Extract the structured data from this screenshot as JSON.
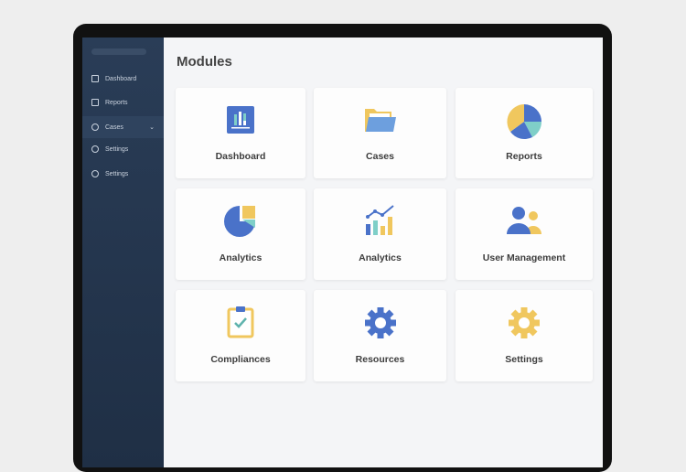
{
  "sidebar": {
    "items": [
      {
        "label": "Dashboard",
        "icon": "dashboard-icon"
      },
      {
        "label": "Reports",
        "icon": "reports-icon"
      },
      {
        "label": "Cases",
        "icon": "search-icon",
        "expandable": true
      },
      {
        "label": "Settings",
        "icon": "settings-icon"
      },
      {
        "label": "Settings",
        "icon": "settings-icon"
      }
    ]
  },
  "main": {
    "title": "Modules",
    "modules": [
      {
        "label": "Dashboard",
        "icon": "dashboard-chart-icon"
      },
      {
        "label": "Cases",
        "icon": "folder-icon"
      },
      {
        "label": "Reports",
        "icon": "pie-chart-icon"
      },
      {
        "label": "Analytics",
        "icon": "pie-chart-icon"
      },
      {
        "label": "Analytics",
        "icon": "bar-line-chart-icon"
      },
      {
        "label": "User Management",
        "icon": "users-icon"
      },
      {
        "label": "Compliances",
        "icon": "clipboard-check-icon"
      },
      {
        "label": "Resources",
        "icon": "gear-icon"
      },
      {
        "label": "Settings",
        "icon": "gear-icon"
      }
    ]
  },
  "colors": {
    "sidebar": "#243650",
    "blue": "#4a72c9",
    "yellow": "#f0c75e",
    "teal": "#7fcfc8"
  }
}
